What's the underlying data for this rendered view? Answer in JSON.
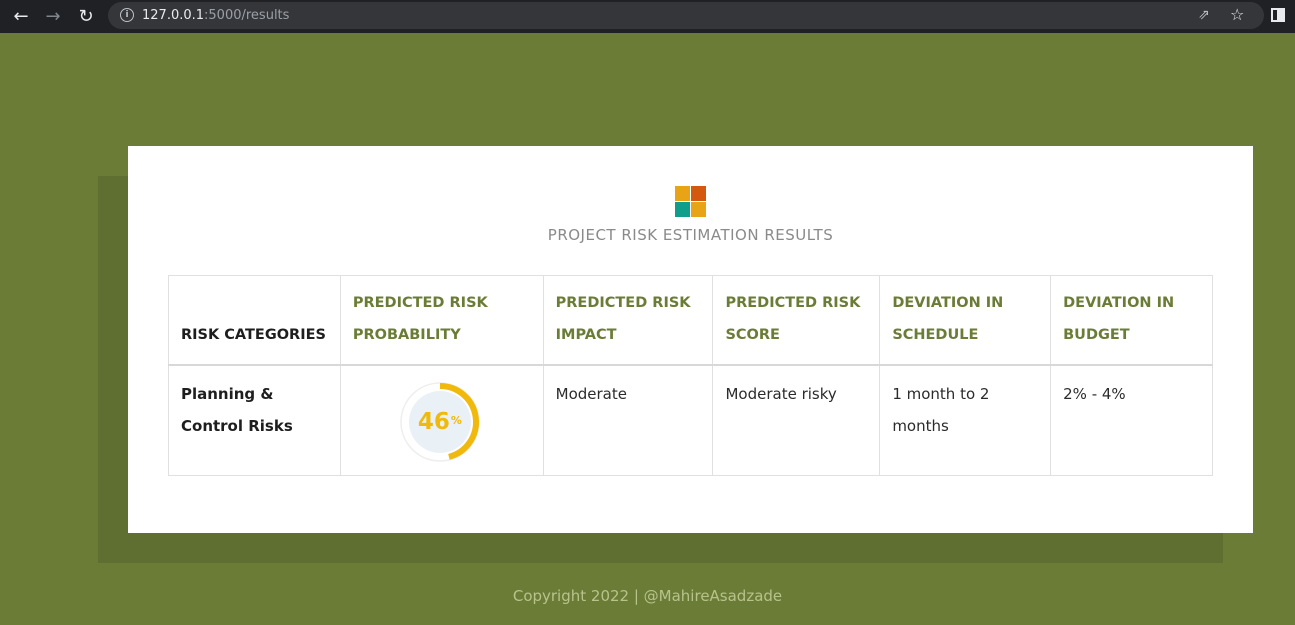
{
  "browser": {
    "url_host": "127.0.0.1",
    "url_rest": ":5000/results"
  },
  "page": {
    "title": "PROJECT RISK ESTIMATION RESULTS",
    "table": {
      "headers": [
        "RISK CATEGORIES",
        "PREDICTED RISK PROBABILITY",
        "PREDICTED RISK IMPACT",
        "PREDICTED RISK SCORE",
        "DEVIATION IN SCHEDULE",
        "DEVIATION IN BUDGET"
      ],
      "row": {
        "category": "Planning & Control Risks",
        "probability_value": "46",
        "probability_unit": "%",
        "probability_fraction": 0.46,
        "impact": "Moderate",
        "score": "Moderate risky",
        "schedule": "1 month to 2 months",
        "budget": "2% - 4%"
      }
    },
    "footer": "Copyright 2022 | @MahireAsadzade"
  },
  "colors": {
    "background": "#6a7c36",
    "accent": "#6a7c36",
    "gauge": "#f0b90b",
    "logo": [
      "#e8a317",
      "#d4590e",
      "#0f9e8a",
      "#e8a317"
    ]
  }
}
